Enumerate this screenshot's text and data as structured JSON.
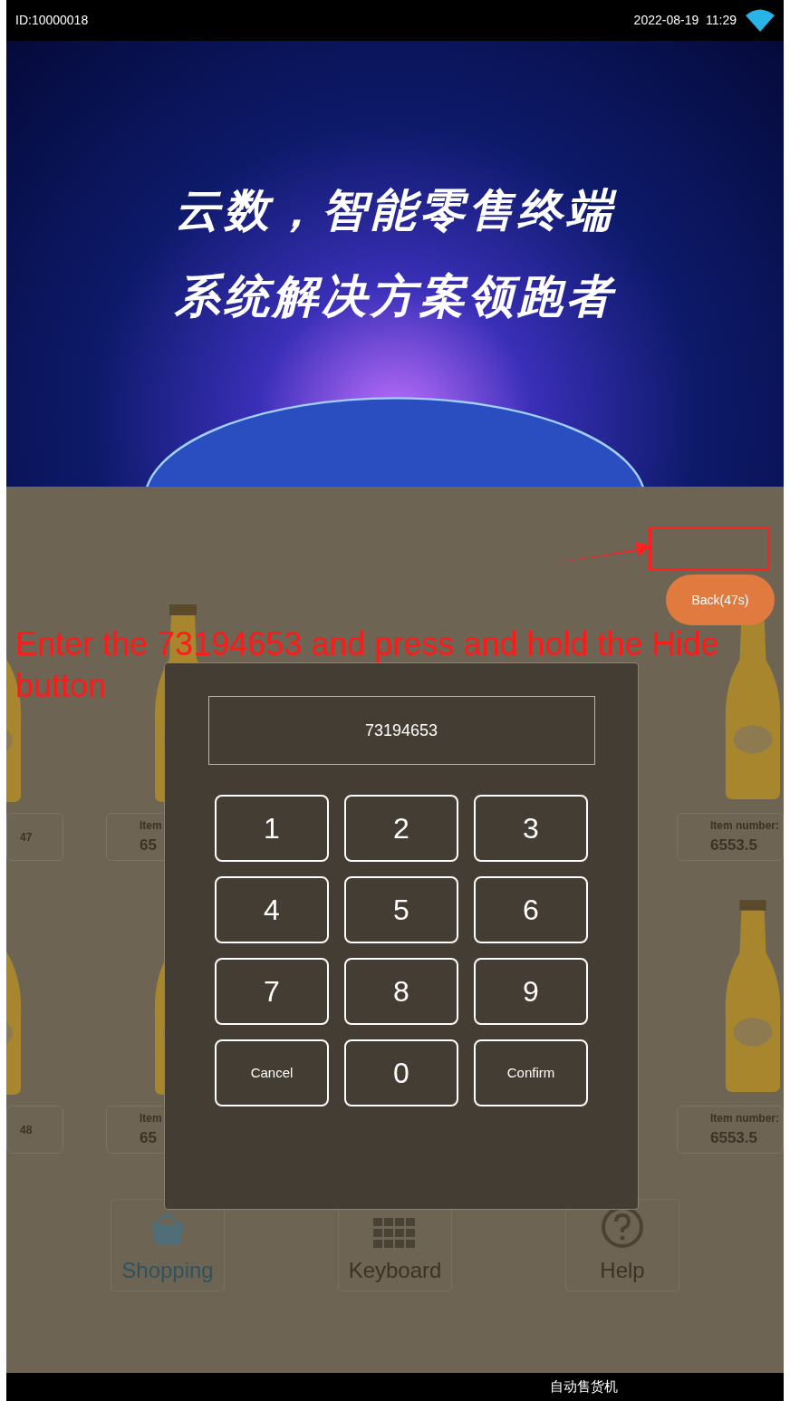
{
  "status_bar": {
    "device_id": "ID:10000018",
    "datetime": "2022-08-19  11:29"
  },
  "banner": {
    "lines": [
      "云数，智能零售终端",
      "系统解决方案领跑者"
    ]
  },
  "products": [
    [
      {
        "kind": "cut_left",
        "label": "47"
      },
      {
        "kind": "partial",
        "label": "Item",
        "price": "65"
      },
      {
        "kind": "cut_right",
        "label": "Item number:",
        "price": "6553.5"
      }
    ],
    [
      {
        "kind": "cut_left",
        "label": "48"
      },
      {
        "kind": "partial",
        "label": "Item",
        "price": "65"
      },
      {
        "kind": "cut_right",
        "label": "Item number:",
        "price": "6553.5"
      }
    ]
  ],
  "back_button": "Back(47s)",
  "annotation": "Enter the 73194653 and press and hold the Hide button",
  "dialog": {
    "value": "73194653",
    "keys": [
      {
        "label": "1",
        "kind": "digit"
      },
      {
        "label": "2",
        "kind": "digit"
      },
      {
        "label": "3",
        "kind": "digit"
      },
      {
        "label": "4",
        "kind": "digit"
      },
      {
        "label": "5",
        "kind": "digit"
      },
      {
        "label": "6",
        "kind": "digit"
      },
      {
        "label": "7",
        "kind": "digit"
      },
      {
        "label": "8",
        "kind": "digit"
      },
      {
        "label": "9",
        "kind": "digit"
      },
      {
        "label": "Cancel",
        "kind": "action"
      },
      {
        "label": "0",
        "kind": "digit"
      },
      {
        "label": "Confirm",
        "kind": "action"
      }
    ]
  },
  "nav": [
    {
      "label": "Shopping",
      "kind": "basket"
    },
    {
      "label": "Keyboard",
      "kind": "keyboard"
    },
    {
      "label": "Help",
      "kind": "help"
    }
  ],
  "footer": "自动售货机"
}
